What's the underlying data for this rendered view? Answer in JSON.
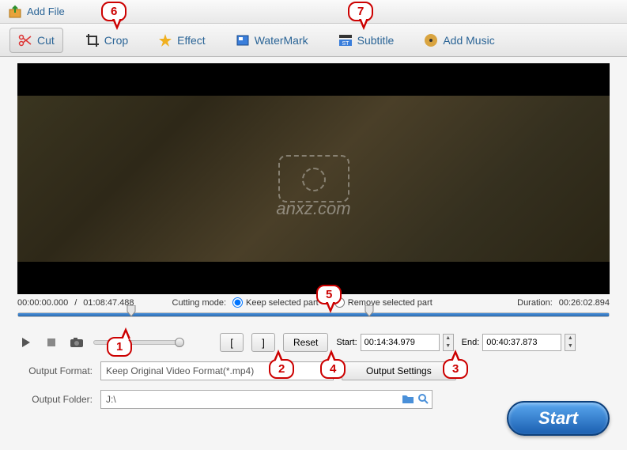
{
  "topbar": {
    "add_file": "Add File"
  },
  "tabs": {
    "cut": "Cut",
    "crop": "Crop",
    "effect": "Effect",
    "watermark": "WaterMark",
    "subtitle": "Subtitle",
    "add_music": "Add Music"
  },
  "watermark_text": "anxz.com",
  "time_info": {
    "current": "00:00:00.000",
    "total": "01:08:47.488",
    "duration_label": "Duration:",
    "duration_value": "00:26:02.894"
  },
  "cutting": {
    "mode_label": "Cutting mode:",
    "keep_label": "Keep selected part",
    "remove_label": "Remove selected part"
  },
  "controls": {
    "reset": "Reset",
    "start_label": "Start:",
    "start_value": "00:14:34.979",
    "end_label": "End:",
    "end_value": "00:40:37.873"
  },
  "output": {
    "format_label": "Output Format:",
    "format_value": "Keep Original Video Format(*.mp4)",
    "settings_btn": "Output Settings",
    "folder_label": "Output Folder:",
    "folder_value": "J:\\"
  },
  "start_btn": "Start",
  "callouts": {
    "c1": "1",
    "c2": "2",
    "c3": "3",
    "c4": "4",
    "c5": "5",
    "c6": "6",
    "c7": "7"
  }
}
